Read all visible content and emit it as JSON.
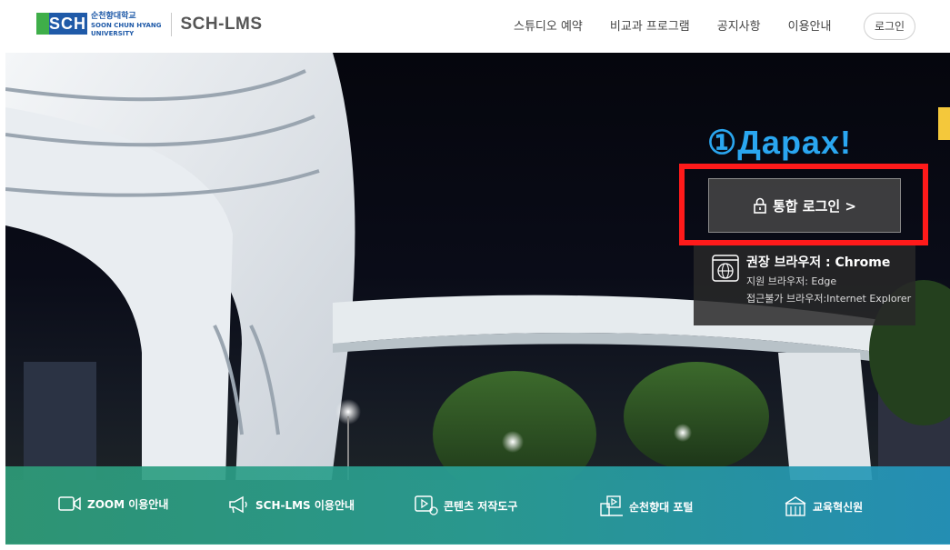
{
  "header": {
    "logo": {
      "mark": "SCH",
      "kr": "순천향대학교",
      "en_line1": "SOON CHUN HYANG",
      "en_line2": "UNIVERSITY"
    },
    "brand": "SCH-LMS",
    "nav": [
      "스튜디오 예약",
      "비교과 프로그램",
      "공지사항",
      "이용안내"
    ],
    "login_label": "로그인"
  },
  "hero": {
    "annotation": "①Дарах!",
    "login_button": "통합 로그인 >",
    "browser": {
      "recommended": "권장 브라우저 : Chrome",
      "supported": "지원 브라우저: Edge",
      "unsupported": "접근불가 브라우저:Internet Explorer"
    }
  },
  "quick_links": [
    {
      "label": "ZOOM 이용안내",
      "icon": "video-camera-icon"
    },
    {
      "label": "SCH-LMS 이용안내",
      "icon": "megaphone-icon"
    },
    {
      "label": "콘텐츠 저작도구",
      "icon": "content-tool-icon"
    },
    {
      "label": "순천향대 포털",
      "icon": "portal-icon"
    },
    {
      "label": "교육혁신원",
      "icon": "building-icon"
    }
  ],
  "colors": {
    "annotation": "#2aa6f0",
    "highlight_box": "#ff1a1a",
    "logo_blue": "#1f5aa8",
    "logo_green": "#3fae49"
  }
}
